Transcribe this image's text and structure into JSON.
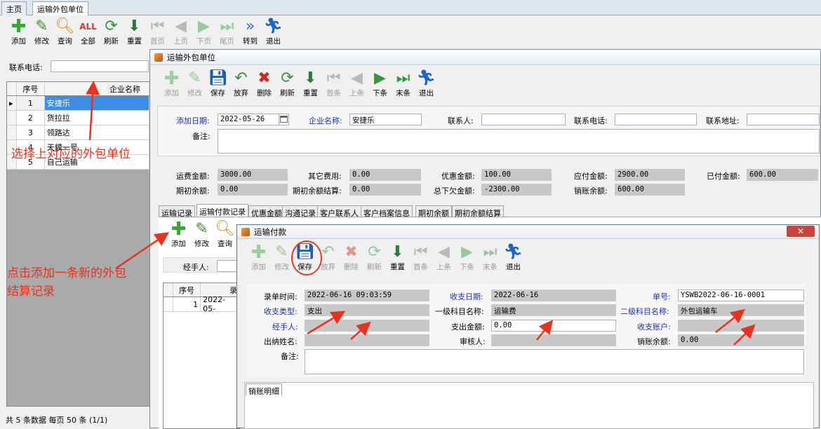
{
  "tabs": [
    "主页",
    "运输外包单位"
  ],
  "main_toolbar": [
    {
      "label": "添加",
      "icon": "plus-icon",
      "enabled": true
    },
    {
      "label": "修改",
      "icon": "edit-icon",
      "enabled": true
    },
    {
      "label": "查询",
      "icon": "search-icon",
      "enabled": true
    },
    {
      "label": "全部",
      "icon": "all-icon",
      "enabled": true
    },
    {
      "label": "刷新",
      "icon": "refresh-icon",
      "enabled": true
    },
    {
      "label": "重置",
      "icon": "reset-icon",
      "enabled": true
    },
    {
      "label": "首页",
      "icon": "first-icon",
      "enabled": false
    },
    {
      "label": "上页",
      "icon": "prev-icon",
      "enabled": false
    },
    {
      "label": "下页",
      "icon": "next-icon",
      "enabled": false
    },
    {
      "label": "尾页",
      "icon": "last-icon",
      "enabled": false
    },
    {
      "label": "转到",
      "icon": "goto-icon",
      "enabled": true
    },
    {
      "label": "退出",
      "icon": "exit-icon",
      "enabled": true
    }
  ],
  "search": {
    "phone_label": "联系电话:"
  },
  "list": {
    "headers": [
      "序号",
      "企业名称"
    ],
    "rows": [
      {
        "no": "1",
        "name": "安捷乐"
      },
      {
        "no": "2",
        "name": "货拉拉"
      },
      {
        "no": "3",
        "name": "领路达"
      },
      {
        "no": "4",
        "name": "天貘一号"
      },
      {
        "no": "5",
        "name": "自己运输"
      }
    ],
    "footer": "共 5 条数据 每页 50 条 (1/1)"
  },
  "annotations": {
    "select": "选择上对应的外包单位",
    "add_line1": "点击添加一条新的外包",
    "add_line2": "结算记录"
  },
  "win1": {
    "title": "运输外包单位",
    "toolbar": [
      {
        "label": "添加",
        "icon": "plus-icon",
        "enabled": false
      },
      {
        "label": "修改",
        "icon": "edit-icon",
        "enabled": false
      },
      {
        "label": "保存",
        "icon": "save-icon",
        "enabled": true
      },
      {
        "label": "放弃",
        "icon": "undo-icon",
        "enabled": true
      },
      {
        "label": "删除",
        "icon": "delete-icon",
        "enabled": true
      },
      {
        "label": "刷新",
        "icon": "refresh-icon",
        "enabled": true
      },
      {
        "label": "重置",
        "icon": "reset-icon",
        "enabled": true
      },
      {
        "label": "首条",
        "icon": "first-icon",
        "enabled": false
      },
      {
        "label": "上条",
        "icon": "prev-icon",
        "enabled": false
      },
      {
        "label": "下条",
        "icon": "next-icon",
        "enabled": true
      },
      {
        "label": "末条",
        "icon": "last-icon",
        "enabled": true
      },
      {
        "label": "退出",
        "icon": "exit-icon",
        "enabled": true
      }
    ],
    "add_date_label": "添加日期:",
    "add_date": "2022-05-26",
    "company_label": "企业名称:",
    "company": "安捷乐",
    "contact_label": "联系人:",
    "phone_label": "联系电话:",
    "address_label": "联系地址:",
    "remark_label": "备注:",
    "freight_label": "运费金额:",
    "freight": "3000.00",
    "other_label": "其它费用:",
    "other": "0.00",
    "discount_label": "优惠金额:",
    "discount": "100.00",
    "payable_label": "应付金额:",
    "payable": "2900.00",
    "paid_label": "已付金额:",
    "paid": "600.00",
    "initial_label": "期初余额:",
    "initial": "0.00",
    "initial_settle_label": "期初余额结算:",
    "initial_settle": "0.00",
    "owed_label": "总下欠金额:",
    "owed": "-2300.00",
    "writeoff_label": "销账余额:",
    "writeoff": "600.00",
    "subtabs": [
      "运输记录",
      "运输付款记录",
      "优惠金额",
      "沟通记录",
      "客户联系人",
      "客户档案信息",
      "期初余额",
      "期初余额结算"
    ],
    "sub_toolbar": [
      "添加",
      "修改",
      "查询"
    ],
    "handler_label": "经手人:",
    "pay_grid_headers": [
      "序号",
      "录"
    ],
    "pay_grid_row": {
      "no": "1",
      "date": "2022-05-"
    }
  },
  "win2": {
    "title": "运输付款",
    "toolbar": [
      {
        "label": "添加",
        "icon": "plus-icon",
        "enabled": false
      },
      {
        "label": "修改",
        "icon": "edit-icon",
        "enabled": false
      },
      {
        "label": "保存",
        "icon": "save-icon",
        "enabled": true
      },
      {
        "label": "放弃",
        "icon": "undo-icon",
        "enabled": false
      },
      {
        "label": "删除",
        "icon": "delete-icon",
        "enabled": false
      },
      {
        "label": "刷新",
        "icon": "refresh-icon",
        "enabled": false
      },
      {
        "label": "重置",
        "icon": "reset-icon",
        "enabled": true
      },
      {
        "label": "首条",
        "icon": "first-icon",
        "enabled": false
      },
      {
        "label": "上条",
        "icon": "prev-icon",
        "enabled": false
      },
      {
        "label": "下条",
        "icon": "next-icon",
        "enabled": false
      },
      {
        "label": "末条",
        "icon": "last-icon",
        "enabled": false
      },
      {
        "label": "退出",
        "icon": "exit-icon",
        "enabled": true
      }
    ],
    "entry_time_label": "录单时间:",
    "entry_time": "2022-06-16 09:03:59",
    "pay_date_label": "收支日期:",
    "pay_date": "2022-06-16",
    "doc_no_label": "单号:",
    "doc_no": "YSWB2022-06-16-0001",
    "type_label": "收支类型:",
    "type": "支出",
    "subject1_label": "一级科目名称:",
    "subject1": "运输费",
    "subject2_label": "二级科目名称:",
    "subject2": "外包运输车",
    "handler_label": "经手人:",
    "amount_label": "支出金额:",
    "amount": "0.00",
    "account_label": "收支账户:",
    "cashier_label": "出纳姓名:",
    "auditor_label": "审核人:",
    "balance_label": "销账余额:",
    "balance": "0.00",
    "remark_label": "备注:",
    "detail_tab": "销账明细"
  }
}
